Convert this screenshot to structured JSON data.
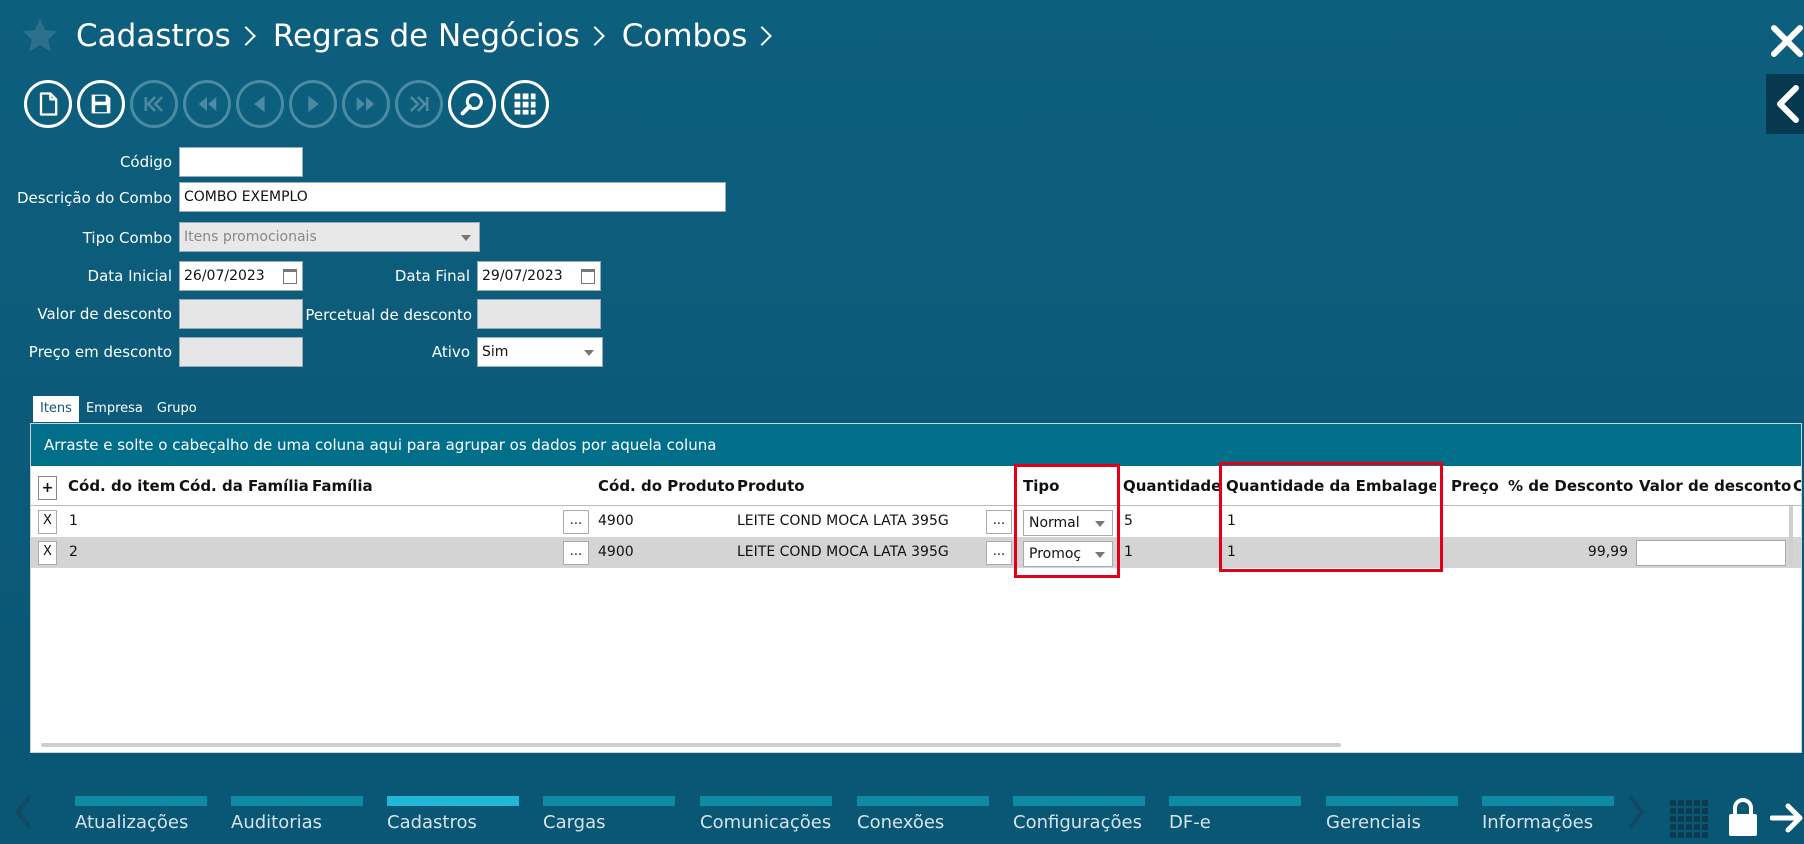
{
  "breadcrumb": [
    "Cadastros",
    "Regras de Negócios",
    "Combos"
  ],
  "form": {
    "codigo": {
      "label": "Código",
      "value": ""
    },
    "descricao": {
      "label": "Descrição do Combo",
      "value": "COMBO EXEMPLO"
    },
    "tipo_combo": {
      "label": "Tipo Combo",
      "value": "Itens promocionais"
    },
    "data_inicial": {
      "label": "Data Inicial",
      "value": "26/07/2023"
    },
    "data_final": {
      "label": "Data Final",
      "value": "29/07/2023"
    },
    "valor_desconto": {
      "label": "Valor de desconto",
      "value": ""
    },
    "percentual_desconto": {
      "label": "Percetual de desconto",
      "value": ""
    },
    "preco_desconto": {
      "label": "Preço em desconto",
      "value": ""
    },
    "ativo": {
      "label": "Ativo",
      "value": "Sim"
    }
  },
  "tabs": [
    "Itens",
    "Empresa",
    "Grupo"
  ],
  "grid": {
    "group_hint": "Arraste e solte o cabeçalho de uma coluna aqui para agrupar os dados por aquela coluna",
    "add_label": "+",
    "more_label": "...",
    "columns": [
      "Cód. do item",
      "Cód. da Família",
      "Família",
      "Cód. do Produto",
      "Produto",
      "Tipo",
      "Quantidade",
      "Quantidade da Embalagem",
      "Preço",
      "% de Desconto",
      "Valor de desconto",
      "C"
    ],
    "rows": [
      {
        "del": "X",
        "cod_item": "1",
        "cod_produto": "4900",
        "produto": "LEITE COND MOCA LATA 395G",
        "tipo": "Normal",
        "quantidade": "5",
        "qtd_embalagem": "1",
        "preco": "",
        "desconto": ""
      },
      {
        "del": "X",
        "cod_item": "2",
        "cod_produto": "4900",
        "produto": "LEITE COND MOCA LATA 395G",
        "tipo": "Promoç",
        "quantidade": "1",
        "qtd_embalagem": "1",
        "preco": "",
        "desconto": "99,99"
      }
    ]
  },
  "bottom_nav": [
    "Atualizações",
    "Auditorias",
    "Cadastros",
    "Cargas",
    "Comunicações",
    "Conexões",
    "Configurações",
    "DF-e",
    "Gerenciais",
    "Informações"
  ],
  "bottom_nav_active": "Cadastros",
  "colors": {
    "background": "#0b5a78",
    "group_hint": "#016f8a",
    "highlight": "#e0001a",
    "nav_active": "#22b6d9"
  }
}
